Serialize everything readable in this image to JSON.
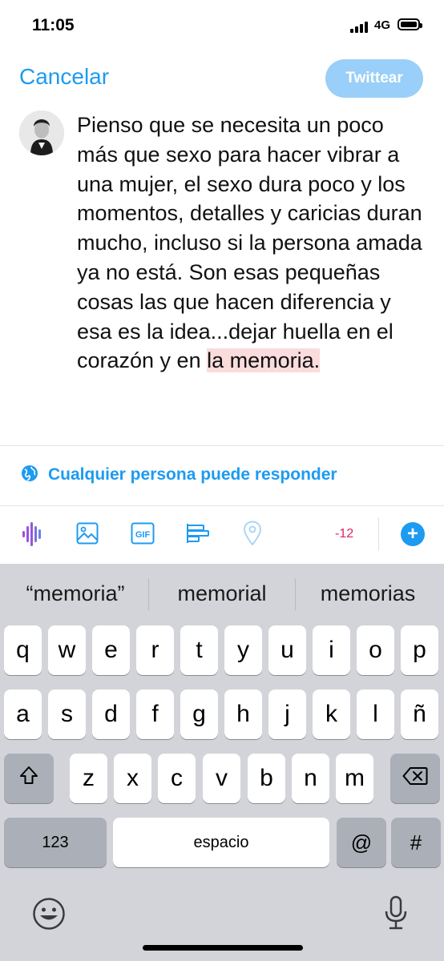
{
  "status_bar": {
    "time": "11:05",
    "network": "4G"
  },
  "compose": {
    "cancel_label": "Cancelar",
    "tweet_label": "Twittear",
    "text_main": "Pienso que se necesita un poco más que sexo para hacer vibrar a una mujer, el sexo dura poco y los momentos, detalles y caricias duran mucho, incluso si la persona amada ya no está. Son esas pequeñas cosas las que hacen diferencia y esa es la idea...dejar huella en el corazón y en ",
    "text_highlight": "la memoria."
  },
  "reply_setting": {
    "label": "Cualquier persona puede responder",
    "icon": "globe-icon"
  },
  "toolbar": {
    "icons": [
      "voice-icon",
      "image-icon",
      "gif-icon",
      "poll-icon",
      "location-icon",
      "add-icon"
    ],
    "char_counter": "-12",
    "gif_label": "GIF",
    "plus_label": "+"
  },
  "keyboard": {
    "suggestions": [
      "“memoria”",
      "memorial",
      "memorias"
    ],
    "row1": [
      "q",
      "w",
      "e",
      "r",
      "t",
      "y",
      "u",
      "i",
      "o",
      "p"
    ],
    "row2": [
      "a",
      "s",
      "d",
      "f",
      "g",
      "h",
      "j",
      "k",
      "l",
      "ñ"
    ],
    "row3": [
      "z",
      "x",
      "c",
      "v",
      "b",
      "n",
      "m"
    ],
    "numbers_key": "123",
    "space_key": "espacio",
    "at_key": "@",
    "hash_key": "#"
  },
  "colors": {
    "accent": "#1d9bf0",
    "tweet_disabled": "#99cff8",
    "counter": "#e0245e",
    "highlight": "#fadcdc",
    "voice": "#9b51e0"
  }
}
